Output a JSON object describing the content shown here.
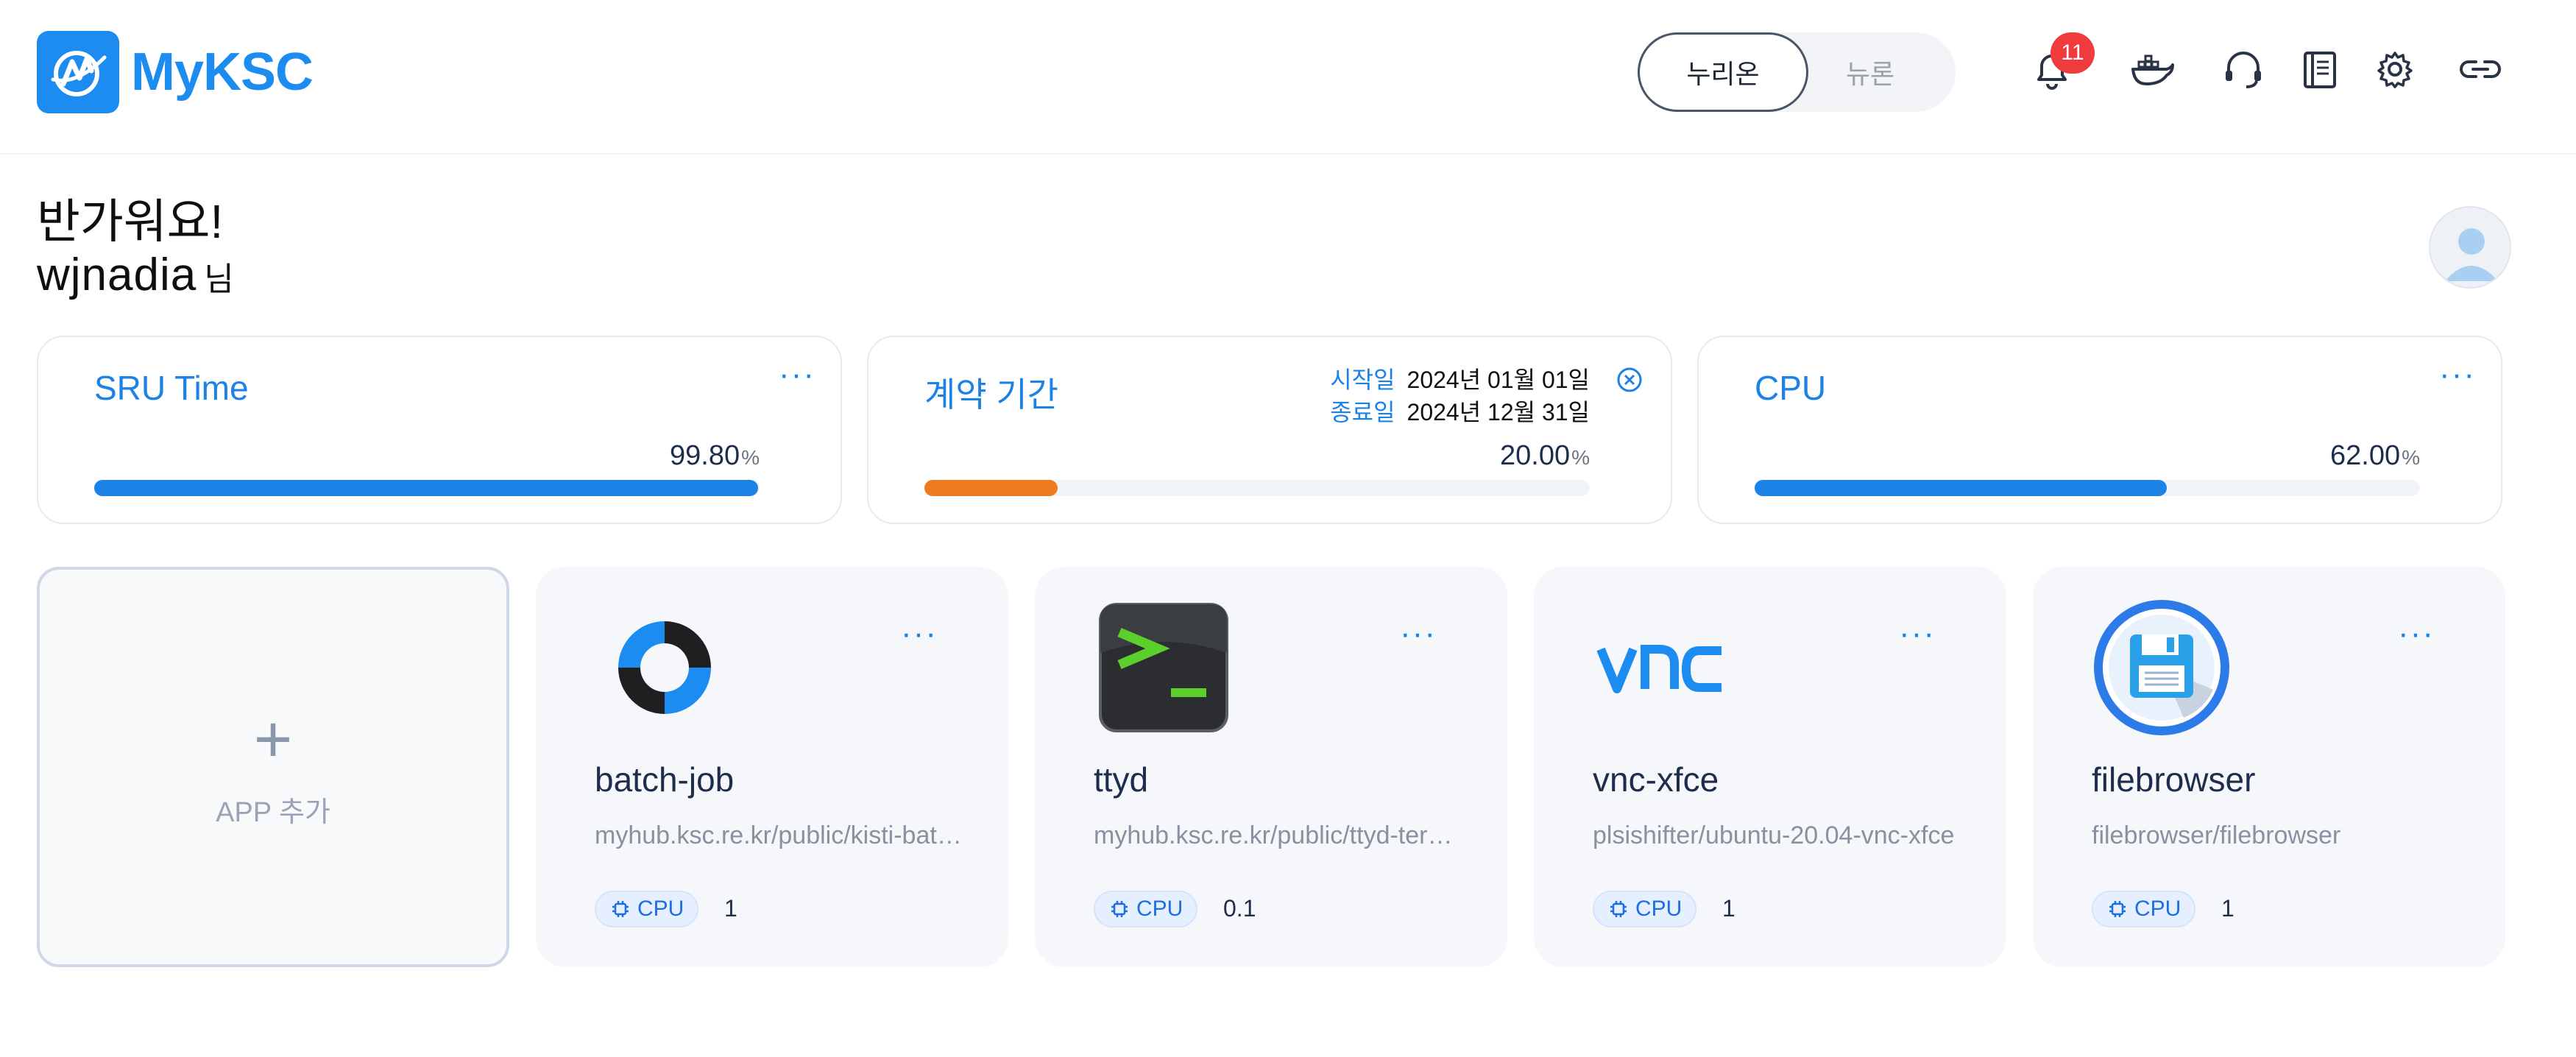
{
  "header": {
    "logo_text": "MyKSC",
    "toggle": {
      "active": "누리온",
      "inactive": "뉴론"
    },
    "notification_count": "11",
    "icons": [
      "bell-icon",
      "docker-icon",
      "headset-icon",
      "notebook-icon",
      "gear-icon",
      "link-icon"
    ]
  },
  "greeting": {
    "line1": "반가워요!",
    "username": "wjnadia",
    "suffix": "님"
  },
  "stats": [
    {
      "title": "SRU Time",
      "value": "99.80",
      "unit": "%",
      "progress": 0.998,
      "color": "#1c82e6",
      "more": "···"
    },
    {
      "title": "계약 기간",
      "value": "20.00",
      "unit": "%",
      "progress": 0.2,
      "color": "#f07c22",
      "start_label": "시작일",
      "start_value": "2024년 01월 01일",
      "end_label": "종료일",
      "end_value": "2024년 12월 31일"
    },
    {
      "title": "CPU",
      "value": "62.00",
      "unit": "%",
      "progress": 0.62,
      "color": "#1c82e6",
      "more": "···"
    }
  ],
  "add_app": {
    "plus": "+",
    "label": "APP 추가"
  },
  "apps": [
    {
      "name": "batch-job",
      "image": "myhub.ksc.re.kr/public/kisti-batch-job",
      "cpu_label": "CPU",
      "cpu_value": "1",
      "more": "···",
      "icon": "batch-job-icon"
    },
    {
      "name": "ttyd",
      "image": "myhub.ksc.re.kr/public/ttyd-terminal",
      "cpu_label": "CPU",
      "cpu_value": "0.1",
      "more": "···",
      "icon": "terminal-icon"
    },
    {
      "name": "vnc-xfce",
      "image": "plsishifter/ubuntu-20.04-vnc-xfce",
      "cpu_label": "CPU",
      "cpu_value": "1",
      "more": "···",
      "icon": "vnc-icon"
    },
    {
      "name": "filebrowser",
      "image": "filebrowser/filebrowser",
      "cpu_label": "CPU",
      "cpu_value": "1",
      "more": "···",
      "icon": "floppy-disk-icon"
    }
  ]
}
